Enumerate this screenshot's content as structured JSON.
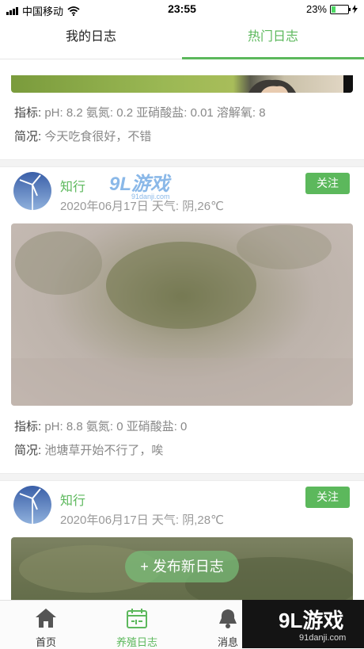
{
  "status": {
    "carrier": "中国移动",
    "time": "23:55",
    "battery": "23%"
  },
  "tabs": [
    {
      "label": "我的日志",
      "active": false
    },
    {
      "label": "热门日志",
      "active": true
    }
  ],
  "watermark": {
    "brand": "9L游戏",
    "url": "91danji.com"
  },
  "entries": [
    {
      "metrics_label": "指标:",
      "metrics": "pH: 8.2 氨氮: 0.2 亚硝酸盐: 0.01 溶解氧: 8",
      "summary_label": "简况:",
      "summary": "今天吃食很好，不错"
    },
    {
      "author": "知行",
      "date": "2020年06月17日 天气: 阴,26℃",
      "follow": "关注",
      "metrics_label": "指标:",
      "metrics": "pH: 8.8 氨氮: 0 亚硝酸盐: 0",
      "summary_label": "简况:",
      "summary": "池塘草开始不行了，唉"
    },
    {
      "author": "知行",
      "date": "2020年06月17日 天气: 阴,28℃",
      "follow": "关注"
    }
  ],
  "fab": {
    "label": "+ 发布新日志"
  },
  "bottom_nav": [
    {
      "label": "首页",
      "icon": "home-icon",
      "active": false
    },
    {
      "label": "养殖日志",
      "icon": "calendar-icon",
      "active": true
    },
    {
      "label": "消息",
      "icon": "bell-icon",
      "active": false
    }
  ],
  "colors": {
    "accent": "#5cb85c",
    "text_muted": "#888888"
  }
}
